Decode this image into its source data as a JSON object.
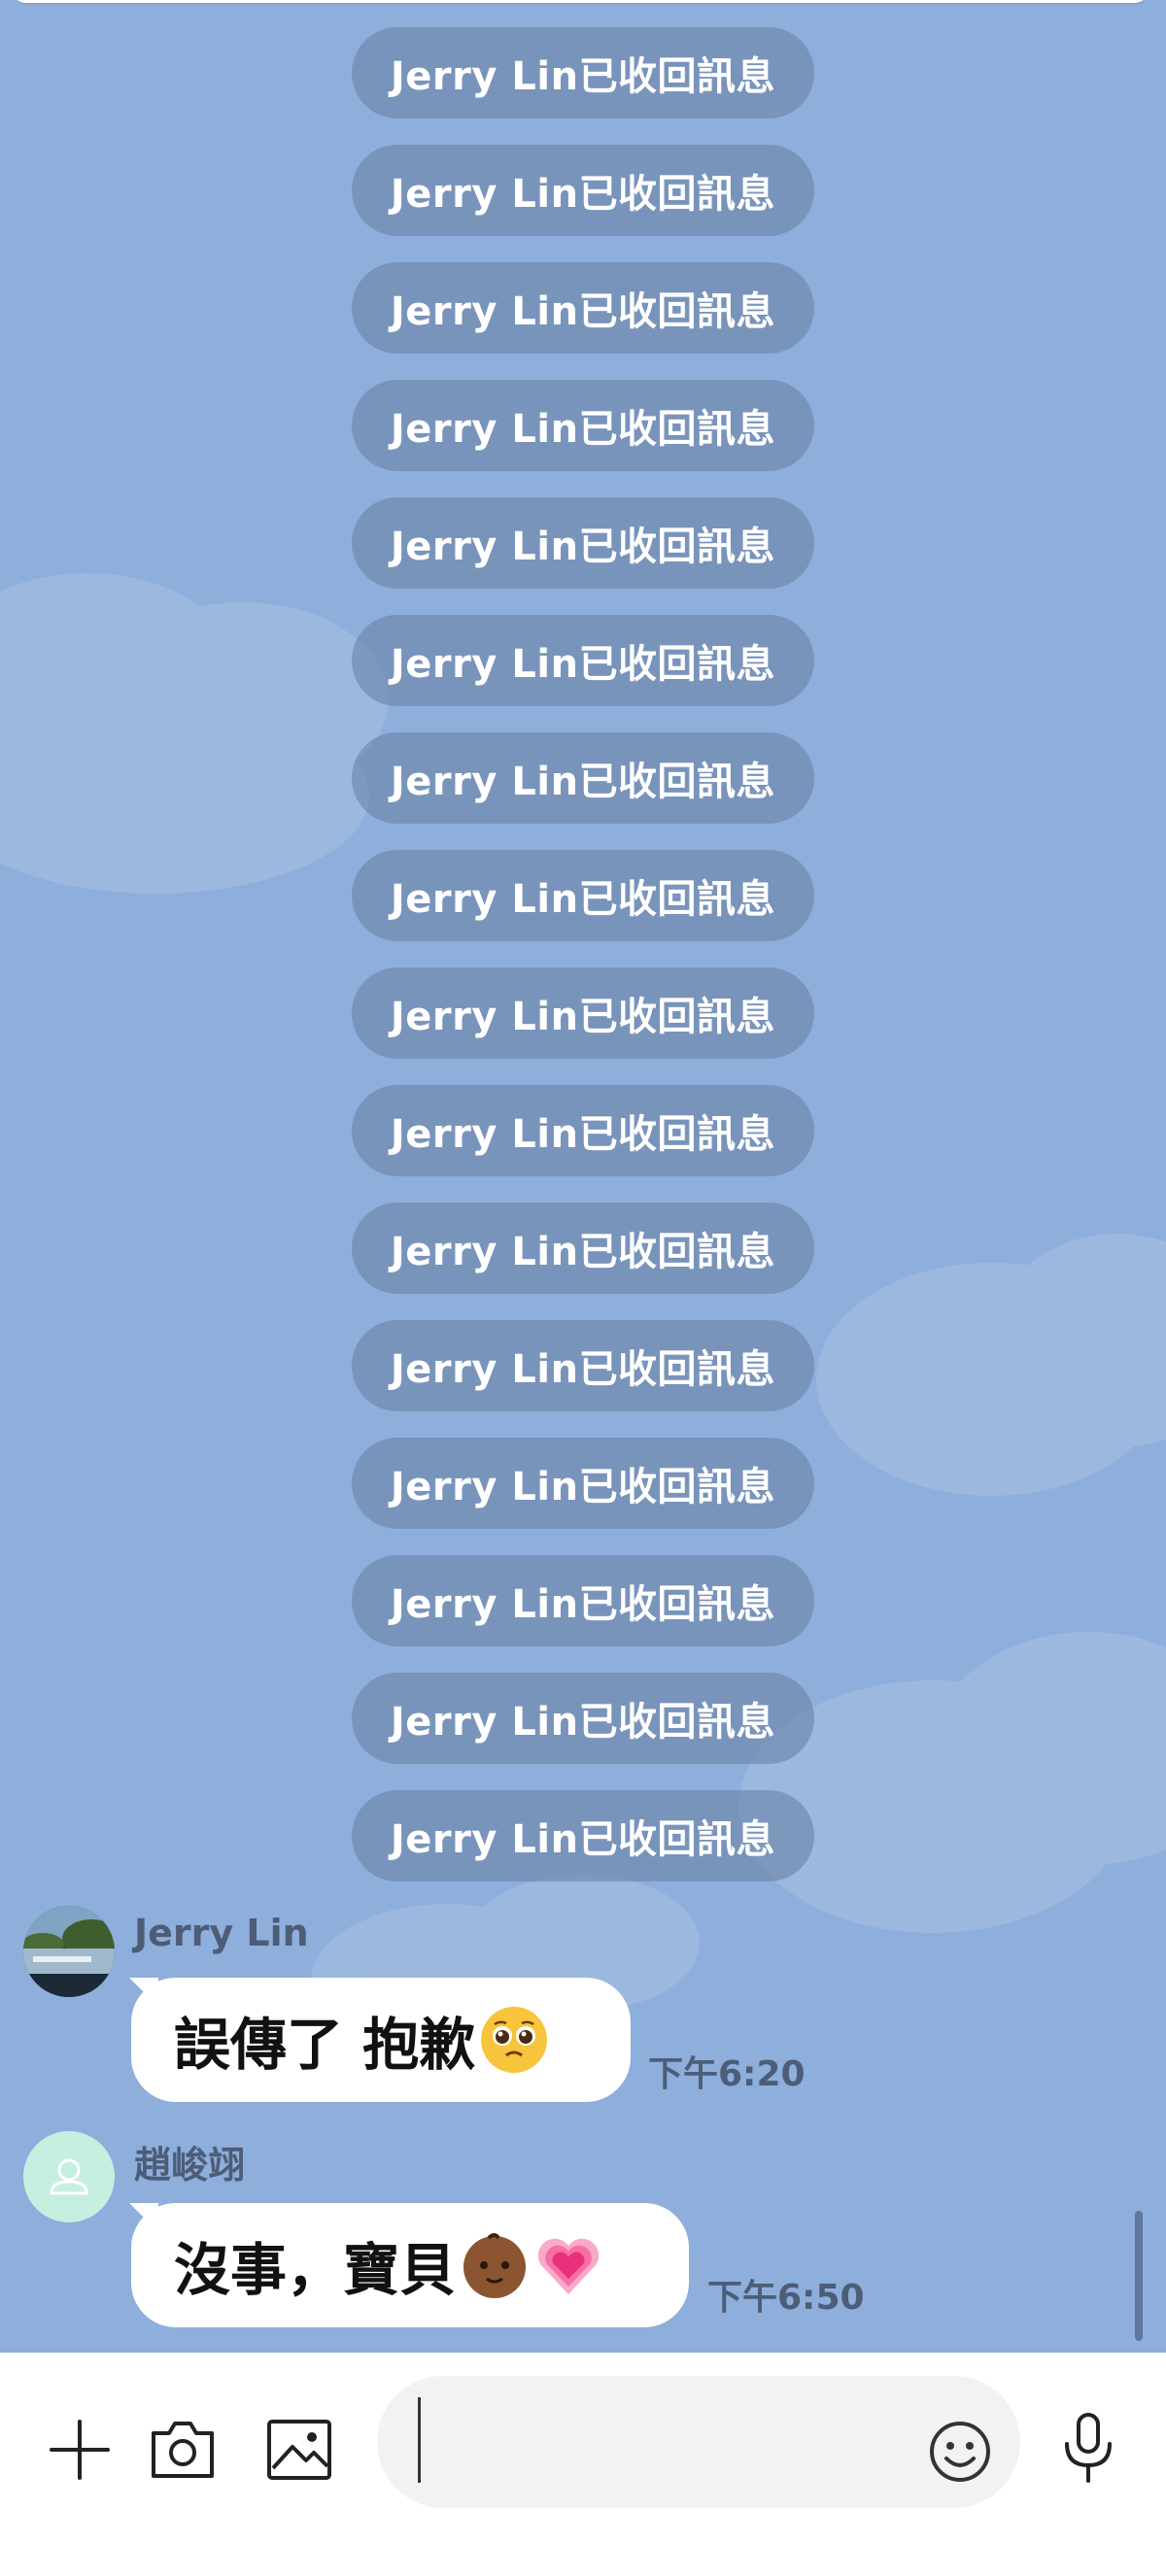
{
  "chat": {
    "recall_notices": [
      {
        "text": "Jerry Lin已收回訊息"
      },
      {
        "text": "Jerry Lin已收回訊息"
      },
      {
        "text": "Jerry Lin已收回訊息"
      },
      {
        "text": "Jerry Lin已收回訊息"
      },
      {
        "text": "Jerry Lin已收回訊息"
      },
      {
        "text": "Jerry Lin已收回訊息"
      },
      {
        "text": "Jerry Lin已收回訊息"
      },
      {
        "text": "Jerry Lin已收回訊息"
      },
      {
        "text": "Jerry Lin已收回訊息"
      },
      {
        "text": "Jerry Lin已收回訊息"
      },
      {
        "text": "Jerry Lin已收回訊息"
      },
      {
        "text": "Jerry Lin已收回訊息"
      },
      {
        "text": "Jerry Lin已收回訊息"
      },
      {
        "text": "Jerry Lin已收回訊息"
      },
      {
        "text": "Jerry Lin已收回訊息"
      },
      {
        "text": "Jerry Lin已收回訊息"
      }
    ],
    "messages": [
      {
        "sender": "Jerry Lin",
        "text": "誤傳了 抱歉",
        "emoji": "pleading-face-emoji",
        "time": "下午6:20"
      },
      {
        "sender": "趙峻翊",
        "text": "沒事，寶貝",
        "emoji": "baby-emoji, growing-heart-emoji",
        "time": "下午6:50"
      }
    ]
  },
  "input": {
    "placeholder": "",
    "value": ""
  },
  "icons": {
    "add": "plus-icon",
    "camera": "camera-icon",
    "gallery": "image-icon",
    "emoji": "smiley-icon",
    "voice": "microphone-icon"
  },
  "colors": {
    "background": "#8eaedb",
    "notice_bg": "#6c84a8",
    "bubble_bg": "#ffffff",
    "meta_text": "#4d5d78"
  }
}
